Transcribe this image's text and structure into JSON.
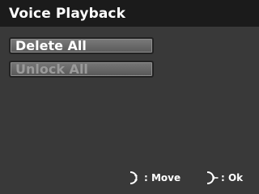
{
  "screen": {
    "title": "Voice Playback"
  },
  "menu": {
    "items": [
      {
        "label": "Delete All",
        "state": "selected"
      },
      {
        "label": "Unlock All",
        "state": "disabled"
      }
    ]
  },
  "footer": {
    "move_label": ": Move",
    "move_icon": "dpad-up-down-icon",
    "ok_label": ": Ok",
    "ok_icon": "dpad-set-icon"
  },
  "colors": {
    "title_bar": "#1b1b1b",
    "background": "#393939",
    "selected_item": "#6a6a6a",
    "disabled_text": "#9a9a9a"
  }
}
